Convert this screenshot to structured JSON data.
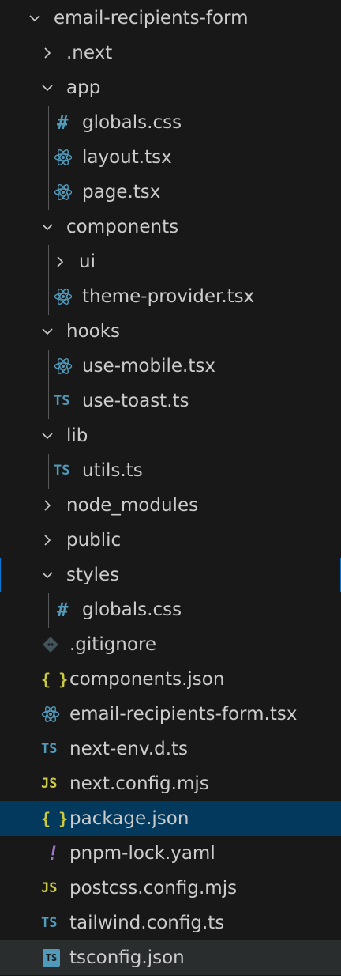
{
  "explorer": {
    "root": {
      "label": "email-recipients-form",
      "expanded": true
    },
    "items": [
      {
        "label": ".next",
        "type": "folder",
        "depth": 1,
        "expanded": false
      },
      {
        "label": "app",
        "type": "folder",
        "depth": 1,
        "expanded": true
      },
      {
        "label": "globals.css",
        "type": "file",
        "icon": "css-hash-icon",
        "depth": 2
      },
      {
        "label": "layout.tsx",
        "type": "file",
        "icon": "react-icon",
        "depth": 2
      },
      {
        "label": "page.tsx",
        "type": "file",
        "icon": "react-icon",
        "depth": 2
      },
      {
        "label": "components",
        "type": "folder",
        "depth": 1,
        "expanded": true
      },
      {
        "label": "ui",
        "type": "folder",
        "depth": 2,
        "expanded": false
      },
      {
        "label": "theme-provider.tsx",
        "type": "file",
        "icon": "react-icon",
        "depth": 2
      },
      {
        "label": "hooks",
        "type": "folder",
        "depth": 1,
        "expanded": true
      },
      {
        "label": "use-mobile.tsx",
        "type": "file",
        "icon": "react-icon",
        "depth": 2
      },
      {
        "label": "use-toast.ts",
        "type": "file",
        "icon": "typescript-icon",
        "depth": 2
      },
      {
        "label": "lib",
        "type": "folder",
        "depth": 1,
        "expanded": true
      },
      {
        "label": "utils.ts",
        "type": "file",
        "icon": "typescript-icon",
        "depth": 2
      },
      {
        "label": "node_modules",
        "type": "folder",
        "depth": 1,
        "expanded": false
      },
      {
        "label": "public",
        "type": "folder",
        "depth": 1,
        "expanded": false
      },
      {
        "label": "styles",
        "type": "folder",
        "depth": 1,
        "expanded": true,
        "state": "focused"
      },
      {
        "label": "globals.css",
        "type": "file",
        "icon": "css-hash-icon",
        "depth": 2
      },
      {
        "label": ".gitignore",
        "type": "file",
        "icon": "git-icon",
        "depth": 1
      },
      {
        "label": "components.json",
        "type": "file",
        "icon": "json-icon",
        "depth": 1
      },
      {
        "label": "email-recipients-form.tsx",
        "type": "file",
        "icon": "react-icon",
        "depth": 1
      },
      {
        "label": "next-env.d.ts",
        "type": "file",
        "icon": "typescript-icon",
        "depth": 1
      },
      {
        "label": "next.config.mjs",
        "type": "file",
        "icon": "javascript-icon",
        "depth": 1
      },
      {
        "label": "package.json",
        "type": "file",
        "icon": "json-icon",
        "depth": 1,
        "state": "selected"
      },
      {
        "label": "pnpm-lock.yaml",
        "type": "file",
        "icon": "yaml-icon",
        "depth": 1
      },
      {
        "label": "postcss.config.mjs",
        "type": "file",
        "icon": "javascript-icon",
        "depth": 1
      },
      {
        "label": "tailwind.config.ts",
        "type": "file",
        "icon": "typescript-icon",
        "depth": 1
      },
      {
        "label": "tsconfig.json",
        "type": "file",
        "icon": "tsconfig-icon",
        "depth": 1,
        "state": "hover"
      }
    ],
    "icon_glyphs": {
      "css-hash-icon": "#",
      "typescript-icon": "TS",
      "javascript-icon": "JS",
      "json-icon": "{ }",
      "yaml-icon": "!",
      "tsconfig-icon": "TS"
    },
    "colors": {
      "background": "#181818",
      "text": "#cccccc",
      "selected": "#04395e",
      "focus_border": "#0078d4",
      "hover": "#2a2d2e",
      "css_ts": "#519aba",
      "js_json": "#cbcb41",
      "yaml": "#a074c4",
      "git": "#41535b"
    }
  }
}
